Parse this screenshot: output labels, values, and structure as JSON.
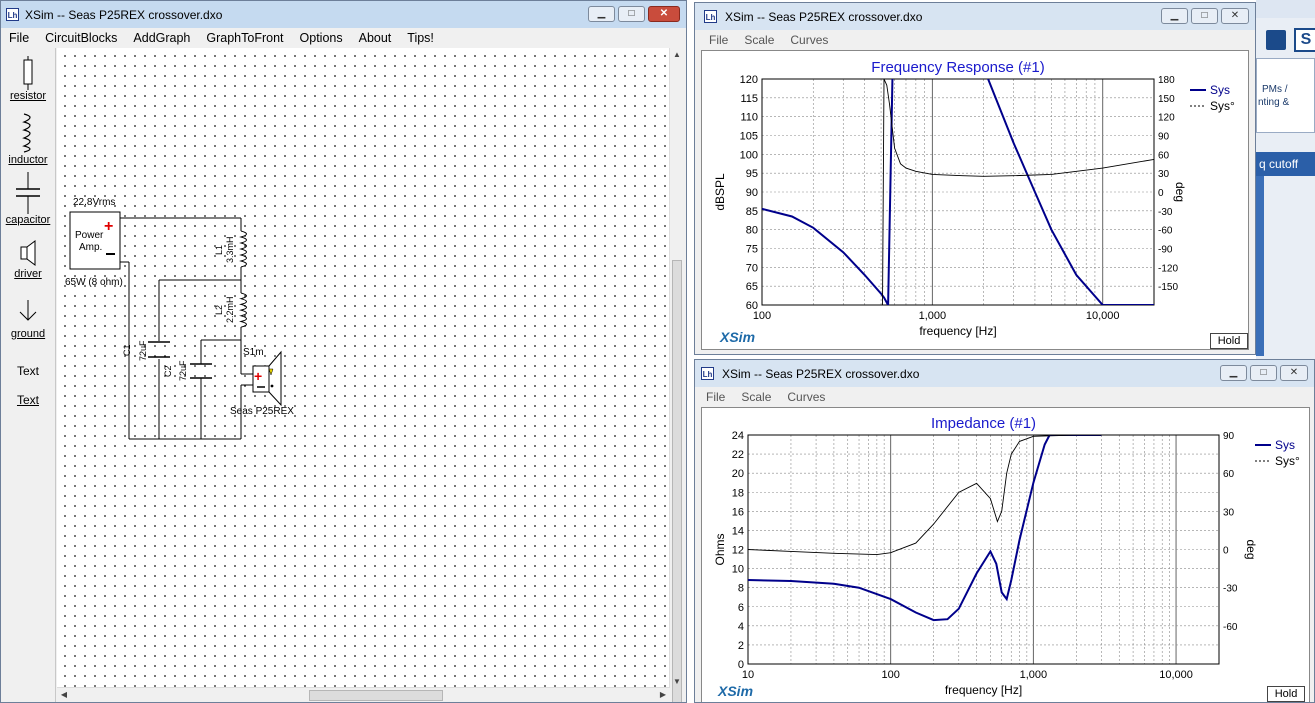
{
  "main_window": {
    "title": "XSim -- Seas P25REX crossover.dxo",
    "menu": [
      "File",
      "CircuitBlocks",
      "AddGraph",
      "GraphToFront",
      "Options",
      "About",
      "Tips!"
    ],
    "toolbox": [
      {
        "icon": "resistor-icon",
        "label": "resistor"
      },
      {
        "icon": "inductor-icon",
        "label": "inductor"
      },
      {
        "icon": "capacitor-icon",
        "label": "capacitor"
      },
      {
        "icon": "driver-icon",
        "label": "driver"
      },
      {
        "icon": "ground-icon",
        "label": "ground"
      },
      {
        "icon": "text-icon",
        "label": "Text"
      },
      {
        "icon": "text-link",
        "label": "Text"
      }
    ],
    "schematic": {
      "amp_voltage": "22.8Vrms",
      "amp_label_line1": "Power",
      "amp_label_line2": "Amp.",
      "amp_power": "65W (8 ohm)",
      "L1_name": "L1",
      "L1_value": "3.3mH",
      "L2_name": "L2",
      "L2_value": "2.2mH",
      "C1_name": "C1",
      "C1_value": "72uF",
      "C2_name": "C2",
      "C2_value": "72uF",
      "driver_name": "S1m",
      "driver_model": "Seas P25REX"
    }
  },
  "freq_window": {
    "title": "XSim -- Seas P25REX crossover.dxo",
    "menu": [
      "File",
      "Scale",
      "Curves"
    ],
    "hold_label": "Hold",
    "brand": "XSim"
  },
  "imp_window": {
    "title": "XSim -- Seas P25REX crossover.dxo",
    "menu": [
      "File",
      "Scale",
      "Curves"
    ],
    "hold_label": "Hold",
    "brand": "XSim"
  },
  "background_app": {
    "text1": "PMs /",
    "text2": "nting &",
    "button": "q cutoff"
  },
  "chart_data": [
    {
      "type": "line",
      "title": "Frequency Response (#1)",
      "xlabel": "frequency [Hz]",
      "ylabel": "dBSPL",
      "y2label": "deg",
      "x_scale": "log",
      "xlim": [
        100,
        20000
      ],
      "ylim": [
        60,
        120
      ],
      "y2lim": [
        -180,
        180
      ],
      "x_ticks": [
        "100",
        "1,000",
        "10,000"
      ],
      "y_ticks": [
        "60",
        "65",
        "70",
        "75",
        "80",
        "85",
        "90",
        "95",
        "100",
        "105",
        "110",
        "115",
        "120"
      ],
      "y2_ticks": [
        "-150",
        "-120",
        "-90",
        "-60",
        "-30",
        "0",
        "30",
        "60",
        "90",
        "120",
        "150",
        "180"
      ],
      "grid": true,
      "legend_position": "top-right",
      "series": [
        {
          "name": "Sys",
          "style": "solid",
          "color": "#00008b",
          "axis": "left",
          "x": [
            100,
            150,
            200,
            300,
            400,
            500,
            520,
            550,
            600,
            700,
            1000,
            1500,
            2000,
            3000,
            4000,
            5000,
            7000,
            10000,
            12000,
            20000
          ],
          "values": [
            85.5,
            83.5,
            80.5,
            74,
            68,
            63,
            62,
            60,
            150,
            150,
            150,
            140,
            123,
            103,
            90,
            80,
            68,
            60,
            60,
            60
          ]
        },
        {
          "name": "Sys°",
          "style": "dashed",
          "color": "#000000",
          "axis": "right",
          "x": [
            510,
            520,
            540,
            560,
            600,
            650,
            700,
            800,
            1000,
            1500,
            2000,
            3000,
            5000,
            10000,
            20000
          ],
          "values": [
            -180,
            180,
            170,
            140,
            70,
            45,
            38,
            33,
            28,
            26,
            25,
            26,
            28,
            38,
            52
          ]
        }
      ]
    },
    {
      "type": "line",
      "title": "Impedance (#1)",
      "xlabel": "frequency [Hz]",
      "ylabel": "Ohms",
      "y2label": "deg",
      "x_scale": "log",
      "xlim": [
        10,
        20000
      ],
      "ylim": [
        0,
        24
      ],
      "y2lim": [
        -90,
        90
      ],
      "x_ticks": [
        "10",
        "100",
        "1,000",
        "10,000"
      ],
      "y_ticks": [
        "0",
        "2",
        "4",
        "6",
        "8",
        "10",
        "12",
        "14",
        "16",
        "18",
        "20",
        "22",
        "24"
      ],
      "y2_ticks": [
        "-60",
        "-30",
        "0",
        "30",
        "60",
        "90"
      ],
      "grid": true,
      "legend_position": "top-right",
      "series": [
        {
          "name": "Sys",
          "style": "solid",
          "color": "#00008b",
          "axis": "left",
          "x": [
            10,
            20,
            40,
            60,
            100,
            150,
            200,
            250,
            300,
            400,
            500,
            550,
            600,
            650,
            700,
            800,
            1000,
            1200,
            1300,
            1500,
            3000
          ],
          "values": [
            8.8,
            8.7,
            8.4,
            8.0,
            6.8,
            5.4,
            4.6,
            4.7,
            5.8,
            9.5,
            11.8,
            10.5,
            7.5,
            6.8,
            8.8,
            13,
            19,
            23,
            24,
            24,
            24
          ]
        },
        {
          "name": "Sys°",
          "style": "dashed",
          "color": "#000000",
          "axis": "right",
          "x": [
            10,
            20,
            40,
            80,
            100,
            150,
            200,
            300,
            400,
            500,
            560,
            600,
            650,
            700,
            800,
            1000,
            2000,
            3000
          ],
          "values": [
            0,
            -1.5,
            -3,
            -4,
            -2.5,
            5,
            20,
            45,
            52,
            40,
            22,
            30,
            60,
            75,
            85,
            89,
            90,
            90
          ]
        }
      ]
    }
  ]
}
